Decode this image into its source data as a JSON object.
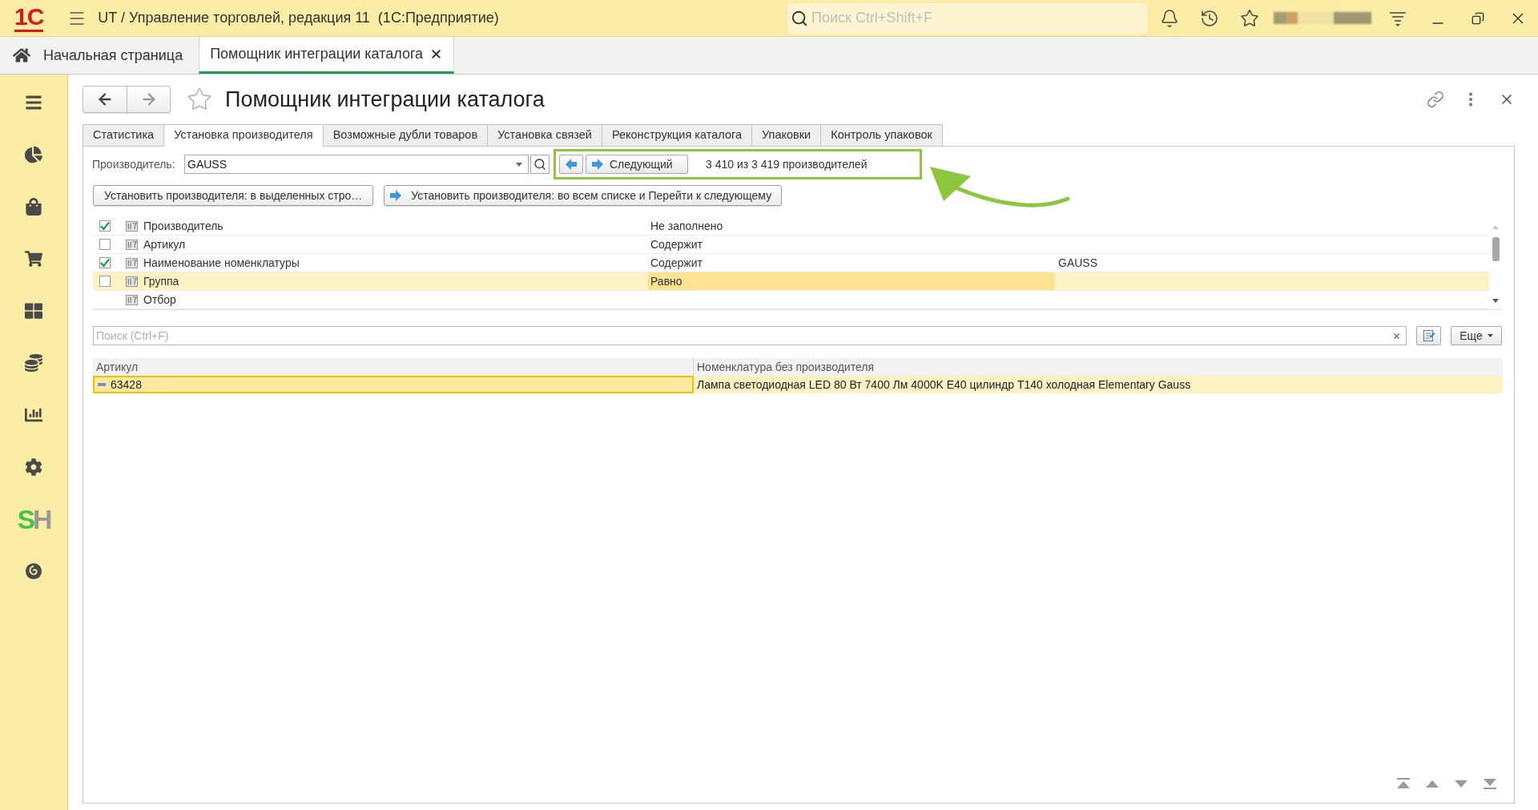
{
  "app_bar": {
    "logo": "1С",
    "title": "UT / Управление торговлей, редакция 11  (1С:Предприятие)",
    "search": {
      "placeholder": "Поиск Ctrl+Shift+F"
    }
  },
  "open_tabs": [
    {
      "kind": "home",
      "label": "Начальная страница",
      "selected": false
    },
    {
      "kind": "document",
      "label": "Помощник интеграции каталога",
      "selected": true
    }
  ],
  "sidebar": {
    "addon_logo": [
      "S",
      "H"
    ]
  },
  "form": {
    "title": "Помощник интеграции каталога",
    "favorite": false,
    "tabs": [
      {
        "label": "Статистика",
        "selected": false
      },
      {
        "label": "Установка производителя",
        "selected": true
      },
      {
        "label": "Возможные дубли товаров",
        "selected": false
      },
      {
        "label": "Установка связей",
        "selected": false
      },
      {
        "label": "Реконструкция каталога",
        "selected": false
      },
      {
        "label": "Упаковки",
        "selected": false
      },
      {
        "label": "Контроль упаковок",
        "selected": false
      }
    ],
    "manufacturer": {
      "label": "Производитель:",
      "value": "GAUSS"
    },
    "navigator": {
      "next_button": "Следующий",
      "counter": "3 410 из 3 419 производителей"
    },
    "actions": [
      {
        "kind": "plain",
        "label": "Установить производителя: в выделенных стро…"
      },
      {
        "kind": "arrow",
        "label": "Установить производителя: во всем списке и Перейти к следующему"
      }
    ],
    "filters": [
      {
        "kind": "field",
        "field": "Производитель",
        "checked": true,
        "condition": "Не заполнено",
        "selected": false
      },
      {
        "kind": "field",
        "field": "Артикул",
        "checked": false,
        "condition": "Содержит",
        "selected": false
      },
      {
        "kind": "field",
        "field": "Наименование номенклатуры",
        "checked": true,
        "condition": "Содержит",
        "value": "GAUSS",
        "selected": false
      },
      {
        "kind": "field",
        "field": "Группа",
        "checked": false,
        "condition": "Равно",
        "selected": true
      },
      {
        "kind": "group",
        "field": "Отбор",
        "selected": false
      }
    ],
    "search": {
      "placeholder": "Поиск (Ctrl+F)"
    },
    "more_button": "Еще",
    "table": {
      "columns": [
        "Артикул",
        "Номенклатура без производителя"
      ],
      "rows": [
        {
          "selected": true,
          "cells": [
            "63428",
            "Лампа светодиодная LED 80 Вт 7400 Лм 4000K E40 цилиндр T140 холодная Elementary Gauss"
          ]
        }
      ]
    }
  }
}
